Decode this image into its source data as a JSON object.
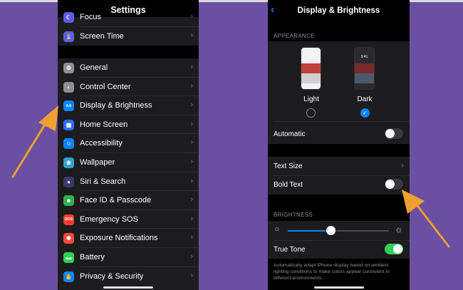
{
  "left_screen": {
    "title": "Settings",
    "partial_item": {
      "label": "Focus",
      "icon": "moon-icon",
      "color": "#5e5ce6"
    },
    "screen_time": {
      "label": "Screen Time",
      "icon": "hourglass-icon",
      "color": "#5e5ce6"
    },
    "items": [
      {
        "label": "General",
        "icon": "gear-icon",
        "color": "#8e8e93",
        "glyph": "⚙"
      },
      {
        "label": "Control Center",
        "icon": "control-center-icon",
        "color": "#8e8e93",
        "glyph": "◐"
      },
      {
        "label": "Display & Brightness",
        "icon": "display-brightness-icon",
        "color": "#0a84ff",
        "glyph": "AA"
      },
      {
        "label": "Home Screen",
        "icon": "home-screen-icon",
        "color": "#2c6bff",
        "glyph": "▦"
      },
      {
        "label": "Accessibility",
        "icon": "accessibility-icon",
        "color": "#0a84ff",
        "glyph": "☺"
      },
      {
        "label": "Wallpaper",
        "icon": "wallpaper-icon",
        "color": "#30a0d0",
        "glyph": "❀"
      },
      {
        "label": "Siri & Search",
        "icon": "siri-icon",
        "color": "#3a3a6a",
        "glyph": "●"
      },
      {
        "label": "Face ID & Passcode",
        "icon": "face-id-icon",
        "color": "#30b050",
        "glyph": "☻"
      },
      {
        "label": "Emergency SOS",
        "icon": "sos-icon",
        "color": "#ff3b30",
        "glyph": "SOS"
      },
      {
        "label": "Exposure Notifications",
        "icon": "exposure-icon",
        "color": "#ff453a",
        "glyph": "✺"
      },
      {
        "label": "Battery",
        "icon": "battery-icon",
        "color": "#30d158",
        "glyph": "▬"
      },
      {
        "label": "Privacy & Security",
        "icon": "hand-icon",
        "color": "#0a84ff",
        "glyph": "✋"
      }
    ]
  },
  "right_screen": {
    "title": "Display & Brightness",
    "appearance_header": "APPEARANCE",
    "light": {
      "label": "Light",
      "time": "9:41",
      "selected": false
    },
    "dark": {
      "label": "Dark",
      "time": "9:41",
      "selected": true
    },
    "automatic": {
      "label": "Automatic",
      "on": false
    },
    "text_size": {
      "label": "Text Size"
    },
    "bold_text": {
      "label": "Bold Text",
      "on": false
    },
    "brightness_header": "BRIGHTNESS",
    "brightness_level": 0.42,
    "true_tone": {
      "label": "True Tone",
      "on": true
    },
    "footer": "Automatically adapt iPhone display based on ambient lighting conditions to make colors appear consistent in different environments."
  },
  "colors": {
    "background": "#6b4fa2",
    "arrow": "#f0a030",
    "toggle_on": "#30d158",
    "accent": "#0a84ff"
  }
}
